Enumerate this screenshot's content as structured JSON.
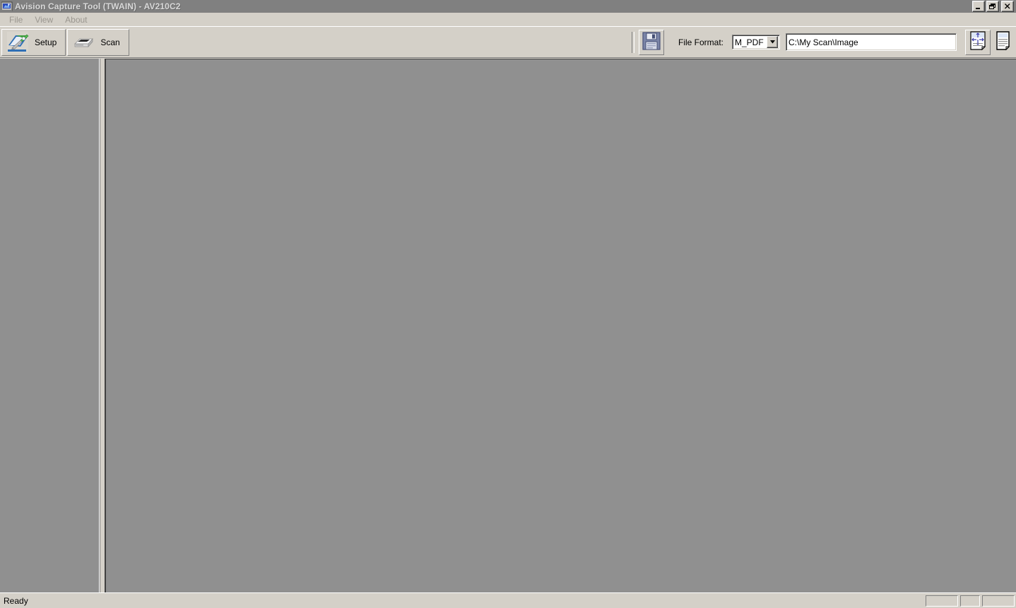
{
  "window": {
    "title": "Avision Capture Tool (TWAIN) - AV210C2",
    "app_icon": "app-scanner-icon",
    "titlebar_color": "#808080",
    "titlebar_text_color": "#d8d8d8",
    "controls": [
      {
        "name": "minimize",
        "glyph": "minimize-icon"
      },
      {
        "name": "restore",
        "glyph": "restore-icon"
      },
      {
        "name": "close",
        "glyph": "close-icon"
      }
    ]
  },
  "menubar": {
    "items": [
      {
        "label": "File"
      },
      {
        "label": "View"
      },
      {
        "label": "About"
      }
    ]
  },
  "toolbar": {
    "setup_label": "Setup",
    "setup_icon": "scanner-setup-icon",
    "scan_label": "Scan",
    "scan_icon": "flatbed-scanner-icon",
    "save_icon": "floppy-save-icon",
    "file_format_label": "File Format:",
    "file_format_value": "M_PDF",
    "file_format_options": [
      "M_PDF"
    ],
    "path_value": "C:\\My Scan\\Image",
    "path_placeholder": "C:\\My Scan\\Image",
    "fit_page_icon": "fit-to-window-icon",
    "actual_size_icon": "actual-size-page-icon"
  },
  "client": {
    "thumbnail_panel_name": "thumbnail-panel",
    "viewer_panel_name": "image-viewer-panel",
    "background_color": "#909090"
  },
  "statusbar": {
    "message": "Ready",
    "panes": [
      "",
      "",
      ""
    ]
  },
  "colors": {
    "face": "#d4d0c8",
    "canvas": "#909090",
    "titlebar": "#808080",
    "menu_text": "#9a968f"
  }
}
